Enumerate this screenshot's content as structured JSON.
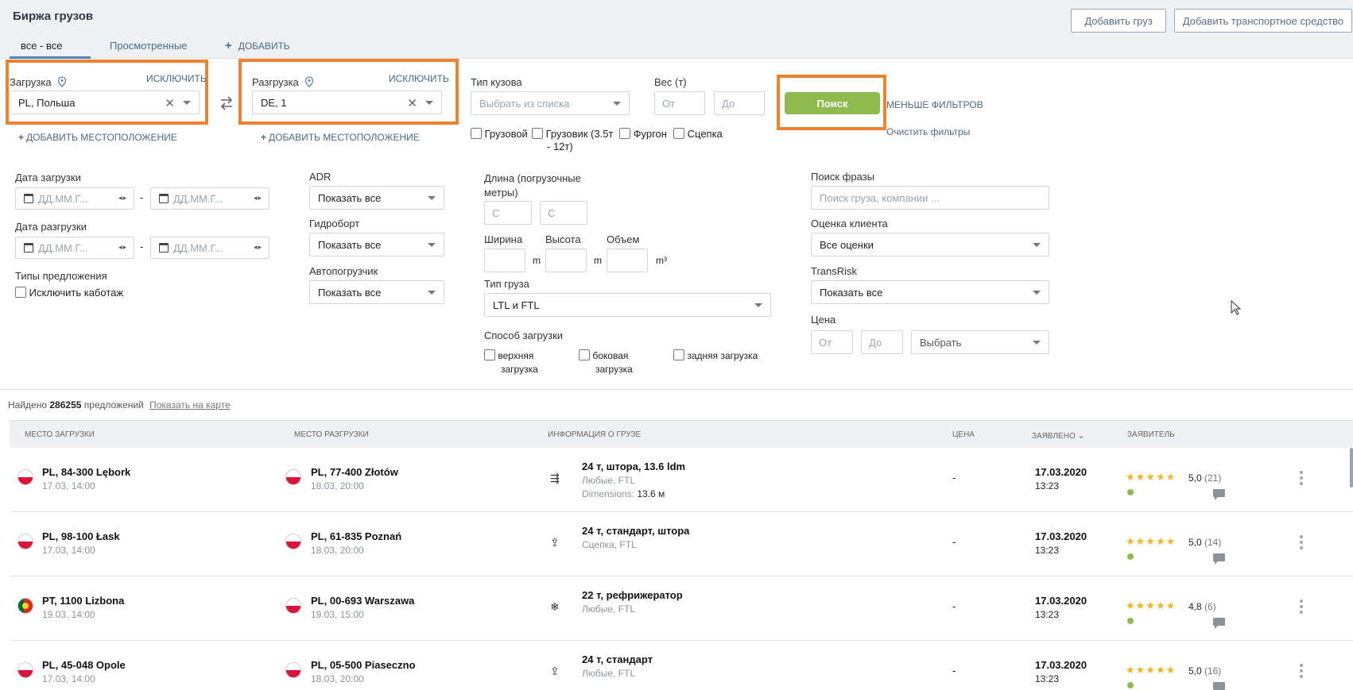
{
  "header": {
    "title": "Биржа грузов",
    "add_cargo": "Добавить груз",
    "add_vehicle": "Добавить транспортное средство"
  },
  "tabs": {
    "all": "все - все",
    "viewed": "Просмотренные",
    "add": "ДОБАВИТЬ"
  },
  "loading": {
    "label": "Загрузка",
    "exclude": "ИСКЛЮЧИТЬ",
    "value": "PL,  Польша",
    "add_location": "ДОБАВИТЬ МЕСТОПОЛОЖЕНИЕ"
  },
  "unloading": {
    "label": "Разгрузка",
    "exclude": "ИСКЛЮЧИТЬ",
    "value": "DE, 1",
    "add_location": "ДОБАВИТЬ МЕСТОПОЛОЖЕНИЕ"
  },
  "body_type": {
    "label": "Тип кузова",
    "placeholder": "Выбрать из списка",
    "options": [
      "Грузовой",
      "Грузовик (3.5т",
      "- 12т)",
      "Фургон",
      "Сцепка"
    ]
  },
  "weight": {
    "label": "Вес (т)",
    "from": "От",
    "to": "До"
  },
  "search_button": "Поиск",
  "less_filters": "МЕНЬШЕ ФИЛЬТРОВ",
  "clear_filters": "Очистить фильтры",
  "dates": {
    "load_label": "Дата загрузки",
    "unload_label": "Дата разгрузки",
    "placeholder": "ДД.ММ.Г...",
    "dash": "-"
  },
  "offer_types": {
    "label": "Типы предложения",
    "exclude_cabotage": "Исключить каботаж"
  },
  "adr": {
    "label": "ADR",
    "value": "Показать все"
  },
  "tail_lift": {
    "label": "Гидроборт",
    "value": "Показать все"
  },
  "forklift": {
    "label": "Автопогрузчик",
    "value": "Показать все"
  },
  "length": {
    "label1": "Длина (погрузочные",
    "label2": "метры)",
    "ph1": "С",
    "ph2": "С"
  },
  "dims": {
    "width": "Ширина",
    "height": "Высота",
    "volume": "Объем",
    "m1": "m",
    "m2": "m",
    "m3": "m³"
  },
  "cargo_type": {
    "label": "Тип груза",
    "value": "LTL и FTL"
  },
  "loading_method": {
    "label": "Способ загрузки",
    "top1": "верхняя",
    "top2": "загрузка",
    "side1": "боковая",
    "side2": "загрузка",
    "rear": "задняя загрузка"
  },
  "phrase": {
    "label": "Поиск фразы",
    "placeholder": "Поиск груза, компании ..."
  },
  "client_rating": {
    "label": "Оценка клиента",
    "value": "Все оценки"
  },
  "transrisk": {
    "label": "TransRisk",
    "value": "Показать все"
  },
  "price": {
    "label": "Цена",
    "from": "От",
    "to": "До",
    "select": "Выбрать"
  },
  "results": {
    "found_prefix": "Найдено",
    "count": "286255",
    "found_suffix": "предложений",
    "show_map": "Показать на карте"
  },
  "columns": {
    "load_place": "МЕСТО ЗАГРУЗКИ",
    "unload_place": "МЕСТО РАЗГРУЗКИ",
    "cargo_info": "ИНФОРМАЦИЯ О ГРУЗЕ",
    "price": "ЦЕНА",
    "declared": "ЗАЯВЛЕНО",
    "applicant": "ЗАЯВИТЕЛЬ"
  },
  "rows": [
    {
      "from_flag": "pl",
      "from": "PL, 84-300 Lębork",
      "from_time": "17.03, 14:00",
      "to_flag": "pl",
      "to": "PL, 77-400 Złotów",
      "to_time": "18.03, 20:00",
      "icon": "side-load-icon",
      "glyph": "⇶",
      "cargo": "24 т, штора, 13.6 ldm",
      "cargo_sub": "Любые, FTL",
      "extra_label": "Dimensions:",
      "extra_value": "13.6 м",
      "price": "-",
      "date": "17.03.2020",
      "time": "13:23",
      "stars": "★★★★★",
      "score": "5,0",
      "reviews": "(21)"
    },
    {
      "from_flag": "pl",
      "from": "PL, 98-100 Łask",
      "from_time": "17.03, 14:00",
      "to_flag": "pl",
      "to": "PL, 61-835 Poznań",
      "to_time": "18.03, 20:00",
      "icon": "top-load-icon",
      "glyph": "⇪",
      "cargo": "24 т, стандарт, штора",
      "cargo_sub": "Сцепка, FTL",
      "price": "-",
      "date": "17.03.2020",
      "time": "13:23",
      "stars": "★★★★★",
      "score": "5,0",
      "reviews": "(14)"
    },
    {
      "from_flag": "pt",
      "from": "PT, 1100 Lizbona",
      "from_time": "19.03, 14:00",
      "to_flag": "pl",
      "to": "PL, 00-693 Warszawa",
      "to_time": "19.03, 15:00",
      "icon": "snowflake-icon",
      "glyph": "❄",
      "cargo": "22 т, рефрижератор",
      "cargo_sub": "Любые, FTL",
      "price": "-",
      "date": "17.03.2020",
      "time": "13:23",
      "stars": "★★★★★",
      "score": "4,8",
      "reviews": "(6)"
    },
    {
      "from_flag": "pl",
      "from": "PL, 45-048 Opole",
      "from_time": "17.03, 14:00",
      "to_flag": "pl",
      "to": "PL, 05-500 Piaseczno",
      "to_time": "18.03, 20:00",
      "icon": "top-load-icon",
      "glyph": "⇪",
      "cargo": "24 т, стандарт",
      "cargo_sub": "Любые, FTL",
      "price": "-",
      "date": "17.03.2020",
      "time": "13:23",
      "stars": "★★★★★",
      "score": "5,0",
      "reviews": "(16)"
    }
  ]
}
